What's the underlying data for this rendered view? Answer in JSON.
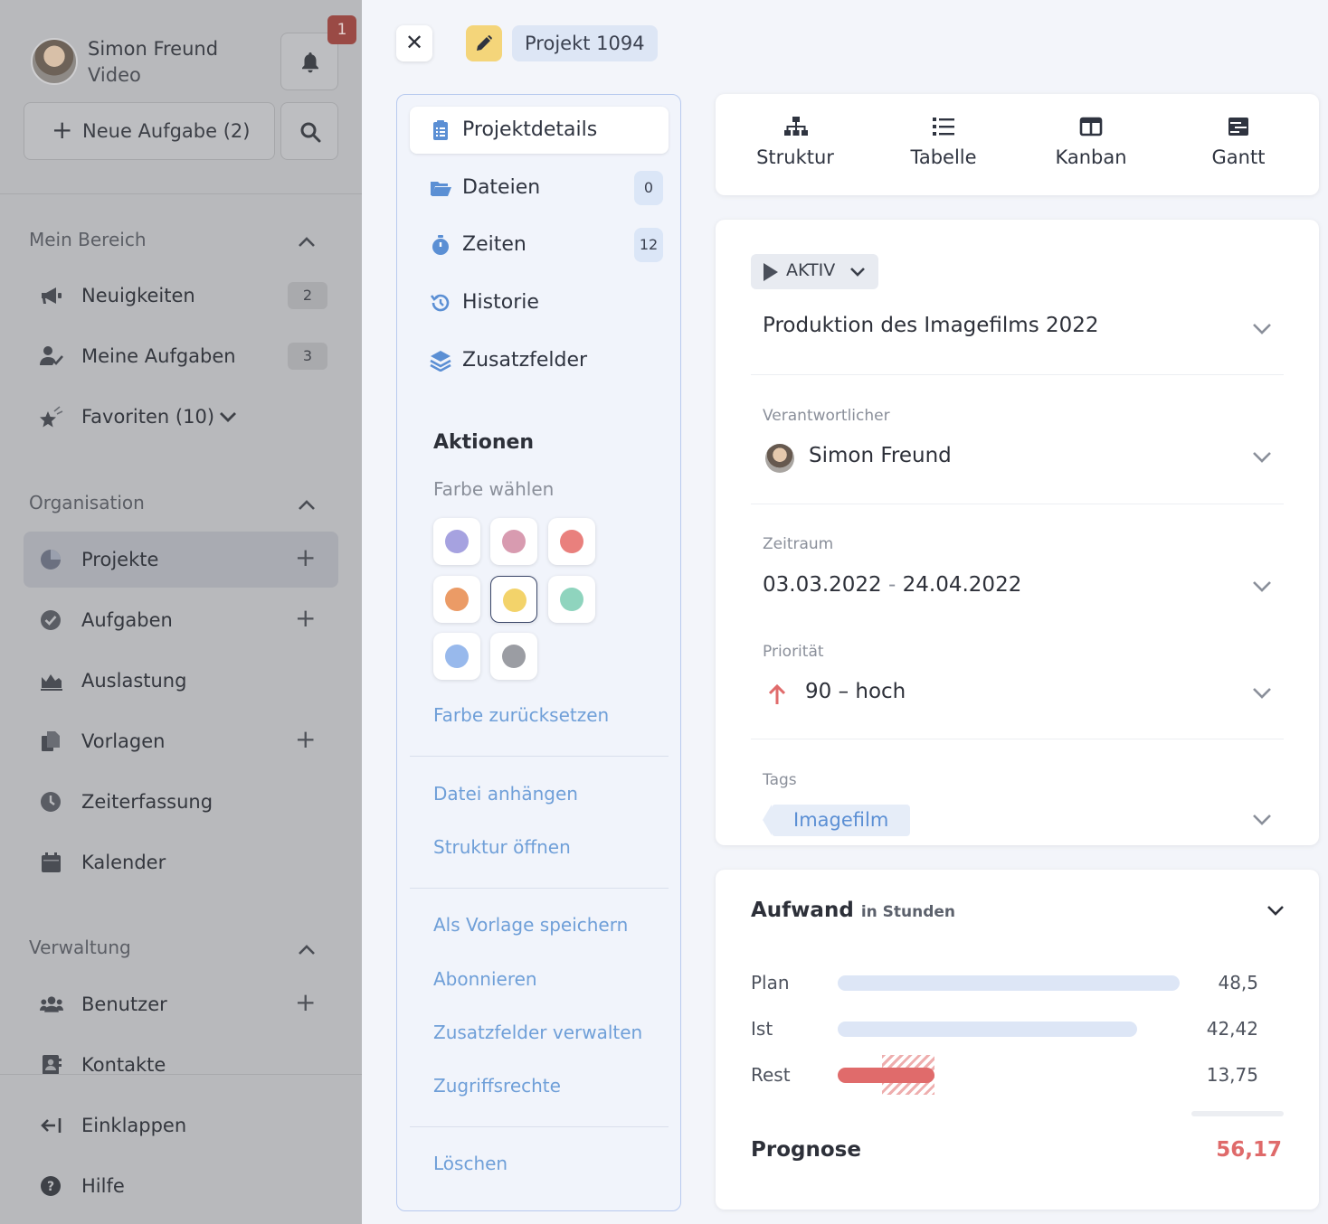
{
  "sidebar": {
    "user_name": "Simon Freund",
    "user_team": "Video",
    "notification_count": "1",
    "new_task_label": "Neue Aufgabe (2)",
    "sections": {
      "mine": "Mein Bereich",
      "org": "Organisation",
      "admin": "Verwaltung"
    },
    "items": {
      "news": {
        "label": "Neuigkeiten",
        "count": "2",
        "icon": "megaphone-icon"
      },
      "mytasks": {
        "label": "Meine Aufgaben",
        "count": "3",
        "icon": "user-check-icon"
      },
      "favorites": {
        "label": "Favoriten (10)",
        "icon": "star-icon"
      },
      "projects": {
        "label": "Projekte",
        "icon": "pie-chart-icon"
      },
      "tasks": {
        "label": "Aufgaben",
        "icon": "check-circle-icon"
      },
      "workload": {
        "label": "Auslastung",
        "icon": "area-chart-icon"
      },
      "templates": {
        "label": "Vorlagen",
        "icon": "copy-icon"
      },
      "timetracking": {
        "label": "Zeiterfassung",
        "icon": "clock-icon"
      },
      "calendar": {
        "label": "Kalender",
        "icon": "calendar-icon"
      },
      "users": {
        "label": "Benutzer",
        "icon": "users-icon"
      },
      "contacts": {
        "label": "Kontakte",
        "icon": "address-card-icon"
      },
      "collapse": {
        "label": "Einklappen",
        "icon": "arrow-left-icon"
      },
      "help": {
        "label": "Hilfe",
        "icon": "question-circle-icon"
      }
    }
  },
  "topbar": {
    "project_label": "Projekt 1094"
  },
  "midpanel": {
    "nav": {
      "details": {
        "label": "Projektdetails"
      },
      "files": {
        "label": "Dateien",
        "count": "0"
      },
      "times": {
        "label": "Zeiten",
        "count": "12"
      },
      "history": {
        "label": "Historie"
      },
      "extra": {
        "label": "Zusatzfelder"
      }
    },
    "actions_heading": "Aktionen",
    "color_label": "Farbe wählen",
    "colors": [
      "#a6a2e0",
      "#d89bb0",
      "#e9807d",
      "#eb9b66",
      "#f3d36a",
      "#8fd4be",
      "#98b9ec",
      "#9b9da3"
    ],
    "selected_color": "#f3d36a",
    "links": {
      "reset_color": "Farbe zurücksetzen",
      "attach": "Datei anhängen",
      "open_structure": "Struktur öffnen",
      "save_template": "Als Vorlage speichern",
      "subscribe": "Abonnieren",
      "manage_fields": "Zusatzfelder verwalten",
      "access": "Zugriffsrechte",
      "delete": "Löschen"
    }
  },
  "views": {
    "structure": "Struktur",
    "table": "Tabelle",
    "kanban": "Kanban",
    "gantt": "Gantt"
  },
  "details": {
    "status": "AKTIV",
    "title": "Produktion des Imagefilms 2022",
    "owner_label": "Verantwortlicher",
    "owner": "Simon Freund",
    "period_label": "Zeitraum",
    "period_start": "03.03.2022",
    "period_sep": "-",
    "period_end": "24.04.2022",
    "priority_label": "Priorität",
    "priority": "90 – hoch",
    "tags_label": "Tags",
    "tag": "Imagefilm"
  },
  "effort": {
    "title": "Aufwand",
    "unit": "in Stunden",
    "rows": [
      {
        "label": "Plan",
        "value": "48,5",
        "num": 48.5
      },
      {
        "label": "Ist",
        "value": "42,42",
        "num": 42.42
      },
      {
        "label": "Rest",
        "value": "13,75",
        "num": 13.75
      }
    ],
    "forecast_label": "Prognose",
    "forecast_value": "56,17",
    "colors": {
      "bar": "#dde6f6",
      "rest": "#e06b6b"
    }
  }
}
